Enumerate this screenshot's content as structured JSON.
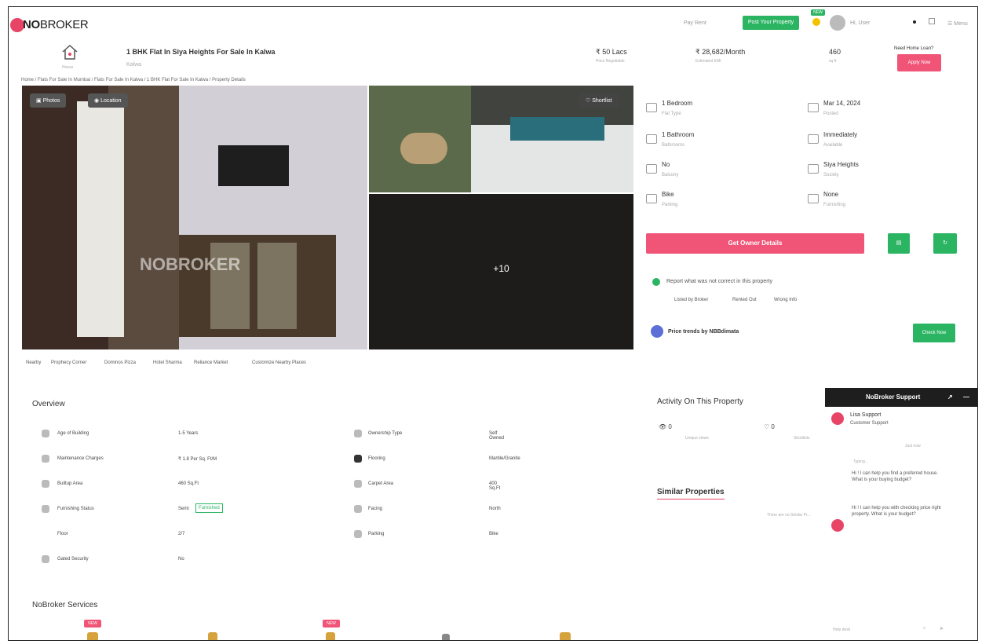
{
  "header": {
    "logo_bold": "NO",
    "logo_rest": "BROKER",
    "pay_rent": "Pay Rent",
    "post_property": "Post Your Property",
    "badge": "NEW",
    "user_name": "Hi, User",
    "menu": "Menu"
  },
  "property": {
    "title": "1 BHK Flat In Siya Heights For Sale In Kalwa",
    "locality": "Kalwa",
    "house_label": "House",
    "price": "₹ 50 Lacs",
    "price_sub": "Price Negotiable",
    "emi": "₹ 28,682/Month",
    "emi_sub": "Estimated EMI",
    "area": "460",
    "area_unit": "sq ft",
    "home_loan": "Need Home Loan?",
    "apply_now": "Apply Now"
  },
  "breadcrumb": "Home  /  Flats For Sale In Mumbai  /  Flats For Sale In Kalwa  /  1 BHK Flat For Sale In Kalwa  /  Property Details",
  "gallery": {
    "photos": "Photos",
    "location": "Location",
    "shortlist": "Shortlist",
    "more_count": "+10",
    "watermark": "NOBROKER"
  },
  "specs": [
    {
      "label": "1 Bedroom",
      "sub": "Flat Type",
      "icon": "bed-icon"
    },
    {
      "label": "Mar 14, 2024",
      "sub": "Posted",
      "icon": "calendar-icon"
    },
    {
      "label": "1 Bathroom",
      "sub": "Bathrooms",
      "icon": "bath-icon"
    },
    {
      "label": "Immediately",
      "sub": "Available",
      "icon": "clock-icon"
    },
    {
      "label": "No",
      "sub": "Balcony",
      "icon": "balcony-icon"
    },
    {
      "label": "Siya Heights",
      "sub": "Society",
      "icon": "building-icon"
    },
    {
      "label": "Bike",
      "sub": "Parking",
      "icon": "car-icon"
    },
    {
      "label": "None",
      "sub": "Furnishing",
      "icon": "sofa-icon"
    }
  ],
  "actions": {
    "owner_details": "Get Owner Details",
    "report": "Report what was not correct in this property",
    "report_links": [
      "Listed by Broker",
      "Rented Out",
      "Wrong Info"
    ],
    "price_trends": "Price trends by NBBdimata",
    "check_now": "Check Now"
  },
  "tabs": [
    "Nearby",
    "Prophecy Corner",
    "Dominos Pizza",
    "Hotel Sharma",
    "Reliance Market",
    "Customize Nearby Places"
  ],
  "overview": {
    "title": "Overview",
    "rows": [
      {
        "label": "Age of Building",
        "value": "1-5 Years",
        "label2": "Ownership Type",
        "value2": "Self Owned"
      },
      {
        "label": "Maintenance Charges",
        "value": "₹ 1.8 Per Sq. Ft/M",
        "label2": "Flooring",
        "value2": "Marble/Granite"
      },
      {
        "label": "Builtup Area",
        "value": "460 Sq.Ft",
        "label2": "Carpet Area",
        "value2": "400 Sq.Ft"
      },
      {
        "label": "Furnishing Status",
        "value": "Semi",
        "chip": "Furnished",
        "label2": "Facing",
        "value2": "North"
      },
      {
        "label": "Floor",
        "value": "2/7",
        "label2": "Parking",
        "value2": "Bike"
      },
      {
        "label": "Gated Security",
        "value": "No",
        "label2": "",
        "value2": ""
      }
    ]
  },
  "services": {
    "title": "NoBroker Services",
    "badge": "NEW"
  },
  "activity": {
    "title": "Activity On This Property",
    "views": "0",
    "views_label": "Unique views",
    "shortlists": "0",
    "shortlists_label": "Shortlists"
  },
  "similar": {
    "title": "Similar Properties",
    "note": "There are no Similar Pr..."
  },
  "support": {
    "title": "NoBroker Support",
    "agent": "Lisa Support",
    "agent_role": "Customer Support",
    "just_now": "Just now",
    "typing": "Typing...",
    "msg1": "Hi ! I can help you find a preferred house. What is your buying budget?",
    "msg2": "Hi ! I can help you with checking price right property. What is your budget?",
    "footer_label": "Help desk"
  },
  "colors": {
    "brand": "#e84566",
    "green": "#2bb563",
    "pink": "#f05477"
  }
}
